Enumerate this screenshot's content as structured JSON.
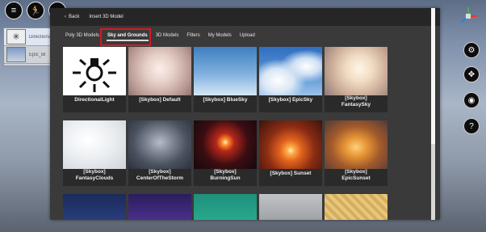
{
  "modal": {
    "back_label": "Back",
    "title": "Insert 3D Model",
    "tabs": [
      {
        "label": "Poly 3D Models"
      },
      {
        "label": "Sky and Grounds"
      },
      {
        "label": "3D Models"
      },
      {
        "label": "Filters"
      },
      {
        "label": "My Models"
      },
      {
        "label": "Upload"
      }
    ],
    "active_tab": "Sky and Grounds",
    "items": [
      {
        "label": "DirectionalLight"
      },
      {
        "label": "[Skybox] Default"
      },
      {
        "label": "[Skybox] BlueSky"
      },
      {
        "label": "[Skybox] EpicSky"
      },
      {
        "label": "[Skybox]\nFantasySky"
      },
      {
        "label": "[Skybox]\nFantasyClouds"
      },
      {
        "label": "[Skybox]\nCenterOfTheStorm"
      },
      {
        "label": "[Skybox]\nBurningSun"
      },
      {
        "label": "[Skybox] Sunset"
      },
      {
        "label": "[Skybox]\nEpicSunset"
      }
    ]
  },
  "left_panel": {
    "rows": [
      {
        "label": "Directional"
      },
      {
        "label": "Epic_Bl"
      }
    ]
  },
  "colors": {
    "highlight": "#d71920",
    "modal_bg": "#3a3a3a",
    "card_bg": "#2a2a2a"
  }
}
